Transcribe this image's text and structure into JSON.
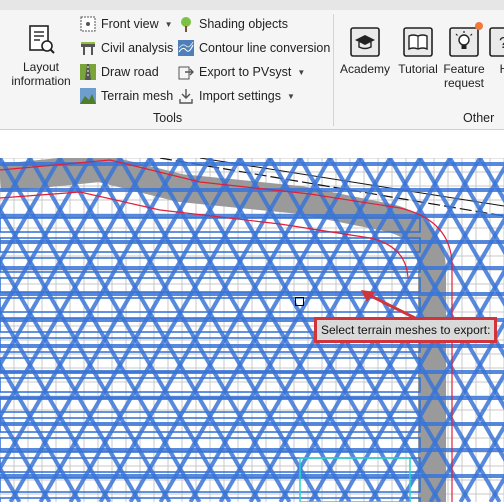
{
  "ribbon": {
    "layout_information": {
      "label_line1": "Layout",
      "label_line2": "information",
      "icon": "layout-document-icon"
    },
    "tools": {
      "items": [
        {
          "label": "Front view",
          "icon": "front-view-icon",
          "has_dropdown": true
        },
        {
          "label": "Civil analysis",
          "icon": "civil-analysis-icon",
          "has_dropdown": false
        },
        {
          "label": "Draw road",
          "icon": "draw-road-icon",
          "has_dropdown": false
        },
        {
          "label": "Terrain mesh",
          "icon": "terrain-mesh-icon",
          "has_dropdown": false
        },
        {
          "label": "Shading objects",
          "icon": "tree-icon",
          "has_dropdown": false
        },
        {
          "label": "Contour line conversion",
          "icon": "contour-icon",
          "has_dropdown": false
        },
        {
          "label": "Export to PVsyst",
          "icon": "export-icon",
          "has_dropdown": true
        },
        {
          "label": "Import settings",
          "icon": "import-icon",
          "has_dropdown": true
        }
      ],
      "group_label": "Tools"
    },
    "other": {
      "academy": {
        "label": "Academy",
        "icon": "graduation-cap-icon"
      },
      "tutorial": {
        "label": "Tutorial",
        "icon": "book-icon"
      },
      "feature_request": {
        "label_line1": "Feature",
        "label_line2": "request",
        "icon": "lightbulb-icon"
      },
      "help": {
        "label": "H",
        "icon": "help-icon"
      },
      "group_label": "Other"
    }
  },
  "canvas": {
    "prompt": "Select terrain meshes to export:",
    "mesh_color": "#3a74d6",
    "road_color": "#9a9a9a",
    "boundary_color": "#e0203a",
    "grid_color": "#c8c8c8"
  }
}
